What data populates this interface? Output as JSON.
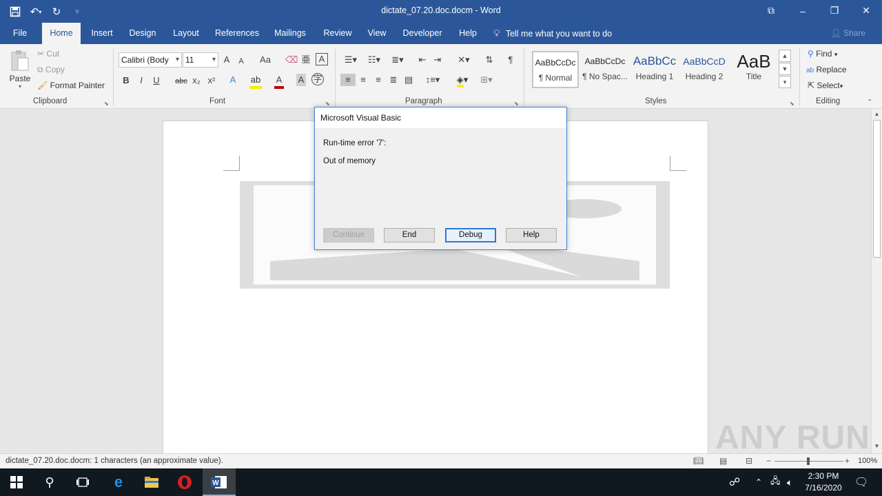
{
  "window": {
    "title": "dictate_07.20.doc.docm  -  Word"
  },
  "ribbon_tabs": [
    "File",
    "Home",
    "Insert",
    "Design",
    "Layout",
    "References",
    "Mailings",
    "Review",
    "View",
    "Developer",
    "Help"
  ],
  "tell_me": "Tell me what you want to do",
  "share": "Share",
  "clipboard": {
    "paste": "Paste",
    "cut": "Cut",
    "copy": "Copy",
    "format_painter": "Format Painter",
    "label": "Clipboard"
  },
  "font": {
    "name": "Calibri (Body",
    "size": "11",
    "grow": "A",
    "shrink": "A",
    "case": "Aa",
    "bold": "B",
    "italic": "I",
    "underline": "U",
    "strike": "abc",
    "sub": "x₂",
    "sup": "x²",
    "label": "Font"
  },
  "paragraph": {
    "label": "Paragraph"
  },
  "styles": {
    "label": "Styles",
    "items": [
      {
        "sample": "AaBbCcDc",
        "name": "¶ Normal"
      },
      {
        "sample": "AaBbCcDc",
        "name": "¶ No Spac..."
      },
      {
        "sample": "AaBbCc",
        "name": "Heading 1"
      },
      {
        "sample": "AaBbCcD",
        "name": "Heading 2"
      },
      {
        "sample": "AaB",
        "name": "Title"
      }
    ]
  },
  "editing": {
    "find": "Find",
    "replace": "Replace",
    "select": "Select",
    "label": "Editing"
  },
  "dialog": {
    "title": "Microsoft Visual Basic",
    "line1": "Run-time error '7':",
    "line2": "Out of memory",
    "buttons": {
      "continue": "Continue",
      "end": "End",
      "debug": "Debug",
      "help": "Help"
    }
  },
  "statusbar": {
    "text": "dictate_07.20.doc.docm: 1 characters (an approximate value).",
    "zoom": "100%"
  },
  "taskbar": {
    "time": "2:30 PM",
    "date": "7/16/2020"
  },
  "watermark": "ANY RUN",
  "colors": {
    "word_blue": "#2b579a",
    "dialog_border": "#3c7fd2",
    "taskbar": "#101820"
  }
}
